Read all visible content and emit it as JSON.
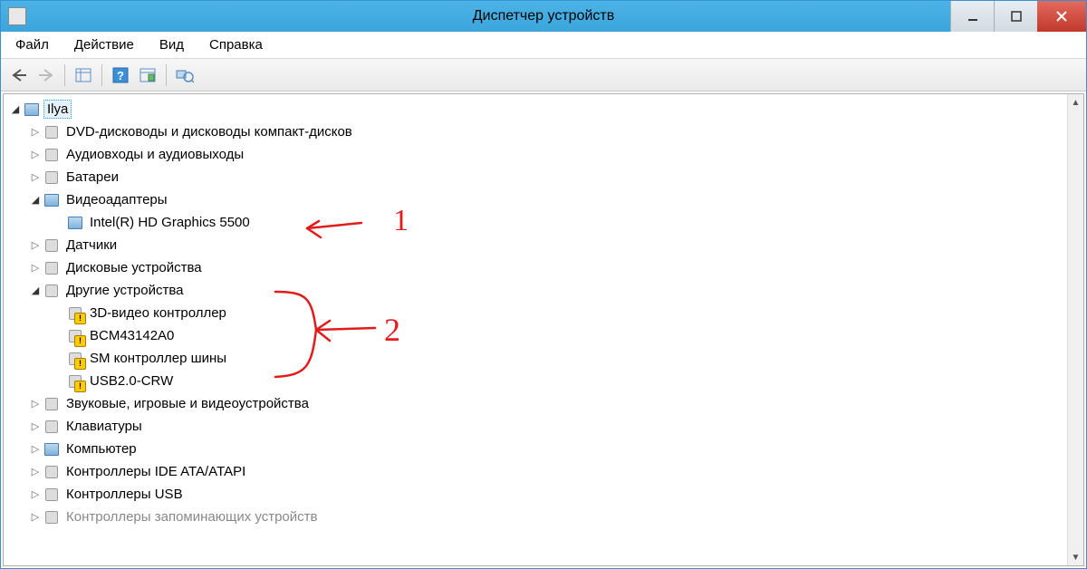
{
  "window": {
    "title": "Диспетчер устройств"
  },
  "menu": {
    "file": "Файл",
    "action": "Действие",
    "view": "Вид",
    "help": "Справка"
  },
  "tree": {
    "root": "Ilya",
    "dvd": "DVD-дисководы и дисководы компакт-дисков",
    "audio_io": "Аудиовходы и аудиовыходы",
    "batteries": "Батареи",
    "video_adapters": "Видеоадаптеры",
    "video_child_1": "Intel(R) HD Graphics 5500",
    "sensors": "Датчики",
    "disk_devices": "Дисковые устройства",
    "other_devices": "Другие устройства",
    "other_child_1": "3D-видео контроллер",
    "other_child_2": "BCM43142A0",
    "other_child_3": "SM контроллер шины",
    "other_child_4": "USB2.0-CRW",
    "sound_game": "Звуковые, игровые и видеоустройства",
    "keyboards": "Клавиатуры",
    "computer": "Компьютер",
    "ide": "Контроллеры IDE ATA/ATAPI",
    "usb": "Контроллеры USB",
    "partial_row": "Контроллеры запоминающих устройств"
  },
  "annotations": {
    "label_1": "1",
    "label_2": "2"
  }
}
